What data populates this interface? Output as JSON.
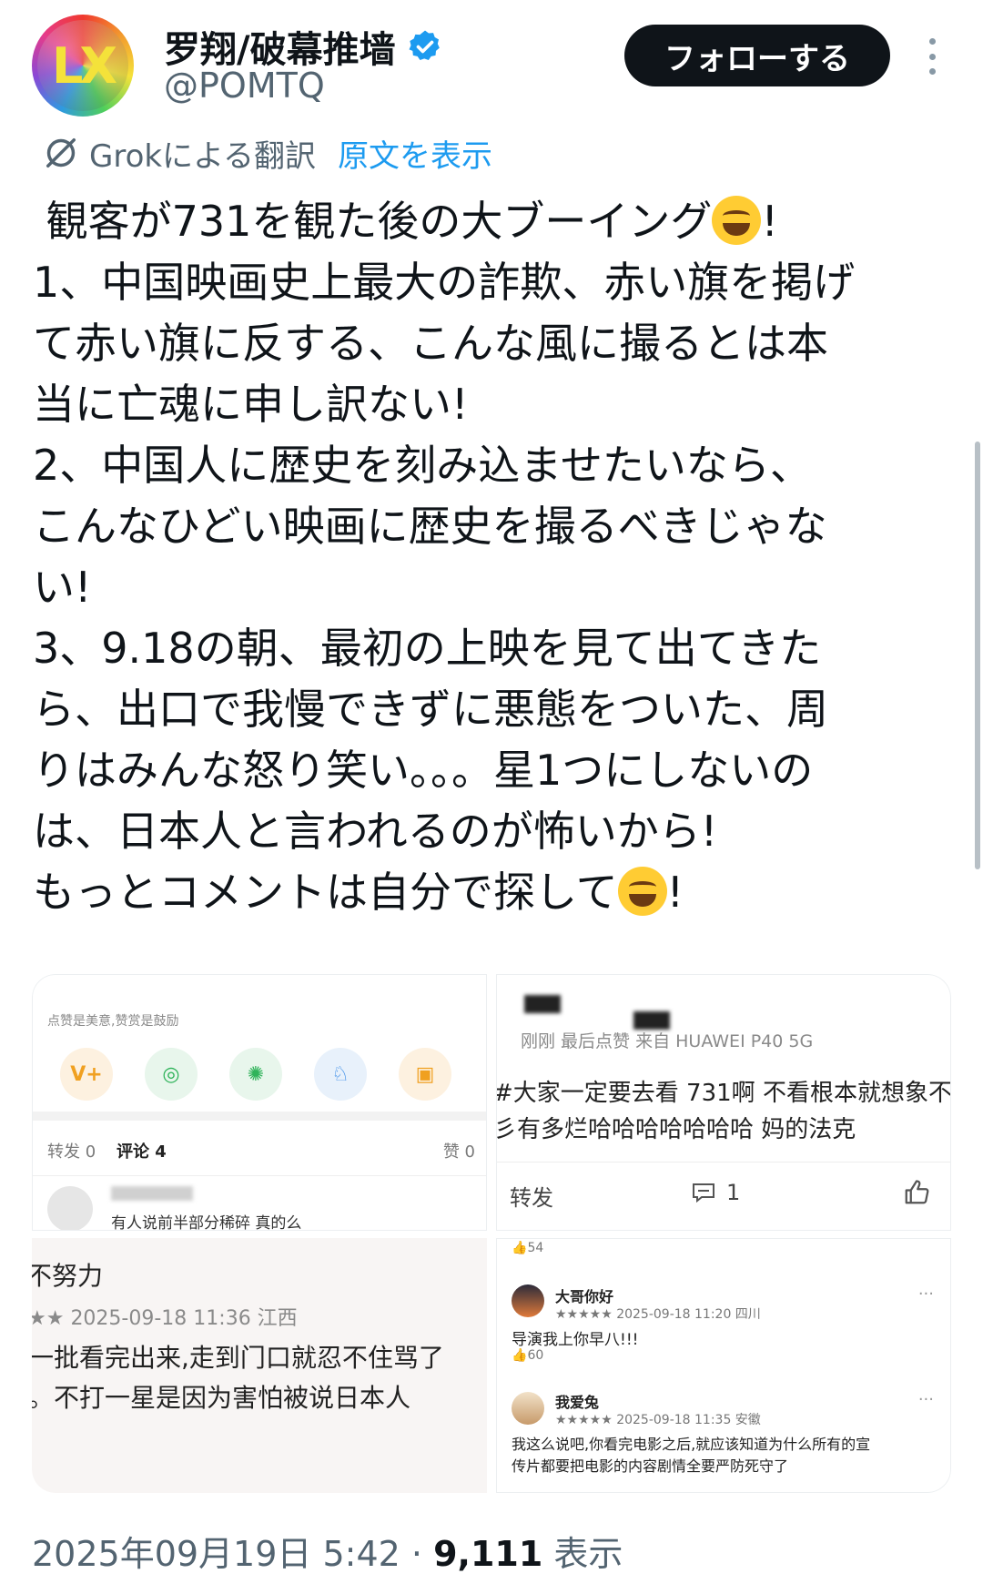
{
  "author": {
    "name": "罗翔/破幕推墙",
    "handle": "@POMTQ",
    "avatar_text": "LX",
    "verified_icon": "verified-badge-icon"
  },
  "header": {
    "follow_label": "フォローする",
    "more_icon": "more-vertical-icon"
  },
  "translation": {
    "label": "Grokによる翻訳",
    "show_original": "原文を表示",
    "icon": "grok-icon"
  },
  "tweet": {
    "lines": [
      " 観客が731を観た後の大ブーイング",
      "!",
      "1、中国映画史上最大の詐欺、赤い旗を掲げ",
      "て赤い旗に反する、こんな風に撮るとは本",
      "当に亡魂に申し訳ない!",
      "2、中国人に歴史を刻み込ませたいなら、",
      "こんなひどい映画に歴史を撮るべきじゃな",
      "い!",
      "3、9.18の朝、最初の上映を見て出てきた",
      "ら、出口で我慢できずに悪態をついた、周",
      "りはみんな怒り笑い。。。星1つにしないの",
      "は、日本人と言われるのが怖いから!",
      "もっとコメントは自分で探して",
      "!"
    ],
    "emoji": "rolling-on-floor-laughing-emoji"
  },
  "images": {
    "img1": {
      "hint": "点赞是美意,赞赏是鼓励",
      "tabs": {
        "forward": "转发 0",
        "comments": "评论 4",
        "likes": "赞 0"
      },
      "comment": "有人说前半部分稀碎      真的么"
    },
    "img2": {
      "meta": "刚刚  最后点赞   来自 HUAWEI P40 5G",
      "text_line1": "#大家一定要去看 731啊  不看根本就想象不",
      "text_line2": "彡有多烂哈哈哈哈哈哈哈  妈的法克",
      "forward": "转发",
      "comment_count": "1"
    },
    "img3": {
      "title": "不努力",
      "meta": "★★ 2025-09-18 11:36 江西",
      "line1": "一批看完出来,走到门口就忍不住骂了",
      "line2": "。不打一星是因为害怕被说日本人"
    },
    "img4": {
      "like_top": "54",
      "user1": "大哥你好",
      "meta1": "★★★★★  2025-09-18 11:20 四川",
      "comment1": "导演我上你早八!!!",
      "like1": "60",
      "user2": "我爱兔",
      "meta2": "★★★★★  2025-09-18 11:35 安徽",
      "comment2a": "我这么说吧,你看完电影之后,就应该知道为什么所有的宣",
      "comment2b": "传片都要把电影的内容剧情全要严防死守了"
    }
  },
  "footer": {
    "timestamp": "2025年09月19日 5:42 · ",
    "views": "9,111",
    "views_label": " 表示"
  },
  "colors": {
    "accent": "#1d9bf0",
    "text": "#0f1419",
    "muted": "#536471",
    "button_bg": "#0f1419"
  }
}
